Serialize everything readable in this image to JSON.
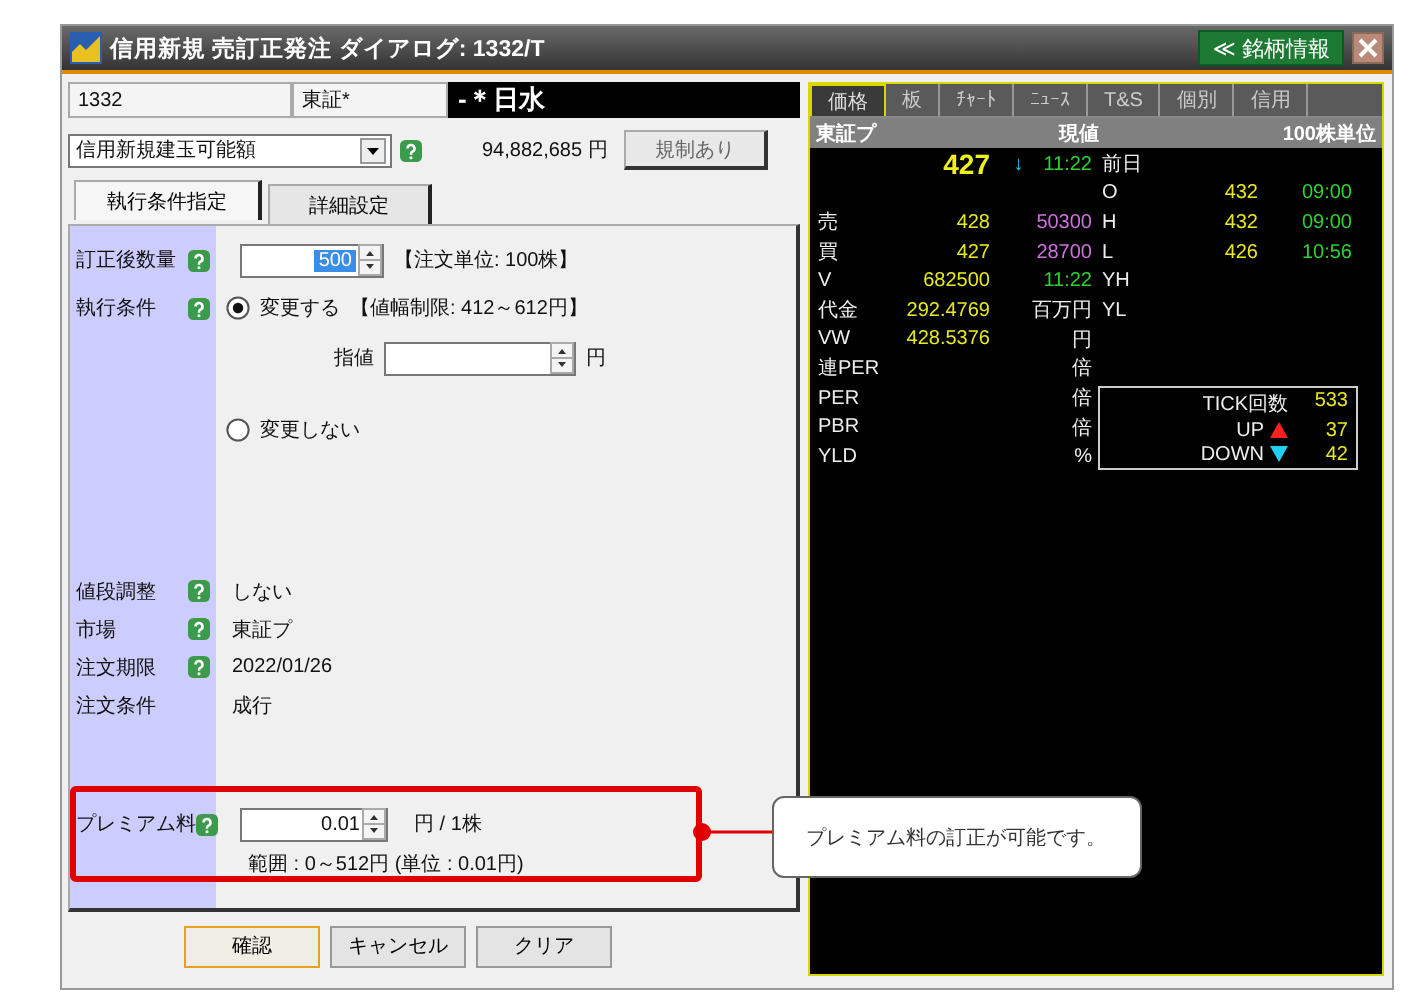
{
  "window": {
    "title": "信用新規 売訂正発注 ダイアログ: 1332/T",
    "info_button": "≪ 銘柄情報"
  },
  "symbol": {
    "code": "1332",
    "market": "東証*",
    "name": "-＊日水"
  },
  "margin": {
    "dropdown": "信用新規建玉可能額",
    "amount": "94,882,685 円",
    "restriction_button": "規制あり"
  },
  "tabs": [
    {
      "label": "執行条件指定",
      "selected": true
    },
    {
      "label": "詳細設定",
      "selected": false
    }
  ],
  "quantity": {
    "label": "訂正後数量",
    "value": "500",
    "note": "【注文単位: 100株】"
  },
  "execution": {
    "label": "執行条件",
    "options": [
      {
        "label": "変更する",
        "selected": true,
        "note": "【値幅制限: 412～612円】"
      },
      {
        "label": "変更しない",
        "selected": false
      }
    ],
    "price_label": "指値",
    "price_unit": "円"
  },
  "details": [
    {
      "label": "値段調整",
      "help": true,
      "value": "しない"
    },
    {
      "label": "市場",
      "help": true,
      "value": "東証プ"
    },
    {
      "label": "注文期限",
      "help": true,
      "value": "2022/01/26"
    },
    {
      "label": "注文条件",
      "help": false,
      "value": "成行"
    }
  ],
  "premium": {
    "label": "プレミアム料",
    "value": "0.01",
    "unit": "円 / 1株",
    "range": "範囲 : 0～512円 (単位 : 0.01円)"
  },
  "buttons": [
    {
      "label": "確認",
      "kind": "default"
    },
    {
      "label": "キャンセル",
      "kind": "normal"
    },
    {
      "label": "クリア",
      "kind": "normal"
    }
  ],
  "callout": "プレミアム料の訂正が可能です。",
  "quote_tabs": [
    {
      "label": "価格",
      "selected": true
    },
    {
      "label": "板",
      "selected": false
    },
    {
      "label": "ﾁｬｰﾄ",
      "selected": false
    },
    {
      "label": "ﾆｭｰｽ",
      "selected": false
    },
    {
      "label": "T&S",
      "selected": false
    },
    {
      "label": "個別",
      "selected": false
    },
    {
      "label": "信用",
      "selected": false
    }
  ],
  "quote_header": {
    "market": "東証プ",
    "title": "現値",
    "unit": "100株単位"
  },
  "current": {
    "price": "427",
    "arrow": "↓",
    "time": "11:22",
    "side": "前日"
  },
  "quote_rows": [
    {
      "side": "O",
      "side_value": "432",
      "side_time": "09:00"
    },
    {
      "label": "売",
      "value": "428",
      "qty": "50300",
      "side": "H",
      "side_value": "432",
      "side_time": "09:00"
    },
    {
      "label": "買",
      "value": "427",
      "qty": "28700",
      "side": "L",
      "side_value": "426",
      "side_time": "10:56"
    },
    {
      "label": "V",
      "value": "682500",
      "time": "11:22",
      "side": "YH"
    },
    {
      "label": "代金",
      "value": "292.4769",
      "unit": "百万円",
      "side": "YL"
    },
    {
      "label": "VW",
      "value": "428.5376",
      "unit": "円"
    },
    {
      "label": "連PER",
      "unit": "倍"
    },
    {
      "label": "PER",
      "unit": "倍"
    },
    {
      "label": "PBR",
      "unit": "倍"
    },
    {
      "label": "YLD",
      "unit": "%"
    }
  ],
  "tick": [
    {
      "label": "TICK回数",
      "kind": "total",
      "value": "533"
    },
    {
      "label": "UP",
      "kind": "up",
      "value": "37"
    },
    {
      "label": "DOWN",
      "kind": "down",
      "value": "42"
    }
  ]
}
